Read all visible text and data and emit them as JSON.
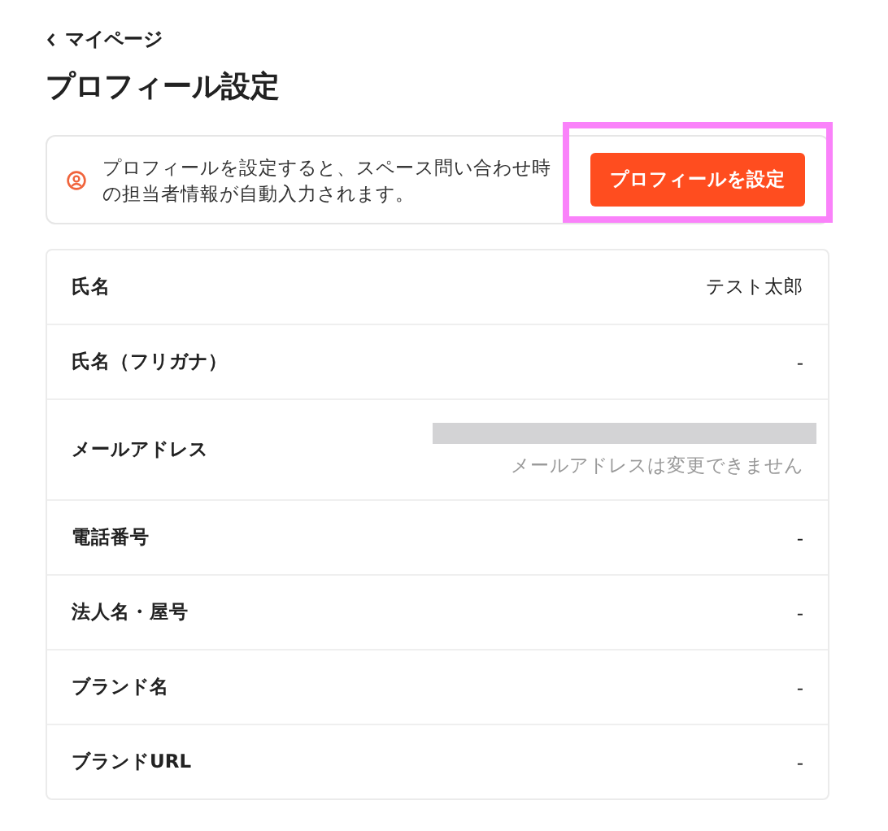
{
  "back_link": {
    "label": "マイページ"
  },
  "title": "プロフィール設定",
  "notice": {
    "text": "プロフィールを設定すると、スペース問い合わせ時の担当者情報が自動入力されます。",
    "button": "プロフィールを設定",
    "highlighted": true
  },
  "fields": [
    {
      "kind": "value",
      "label": "氏名",
      "value": "テスト太郎"
    },
    {
      "kind": "value",
      "label": "氏名（フリガナ）",
      "value": "-"
    },
    {
      "kind": "redacted",
      "label": "メールアドレス",
      "note": "メールアドレスは変更できません"
    },
    {
      "kind": "value",
      "label": "電話番号",
      "value": "-"
    },
    {
      "kind": "value",
      "label": "法人名・屋号",
      "value": "-"
    },
    {
      "kind": "value",
      "label": "ブランド名",
      "value": "-"
    },
    {
      "kind": "value",
      "label": "ブランドURL",
      "value": "-"
    }
  ]
}
